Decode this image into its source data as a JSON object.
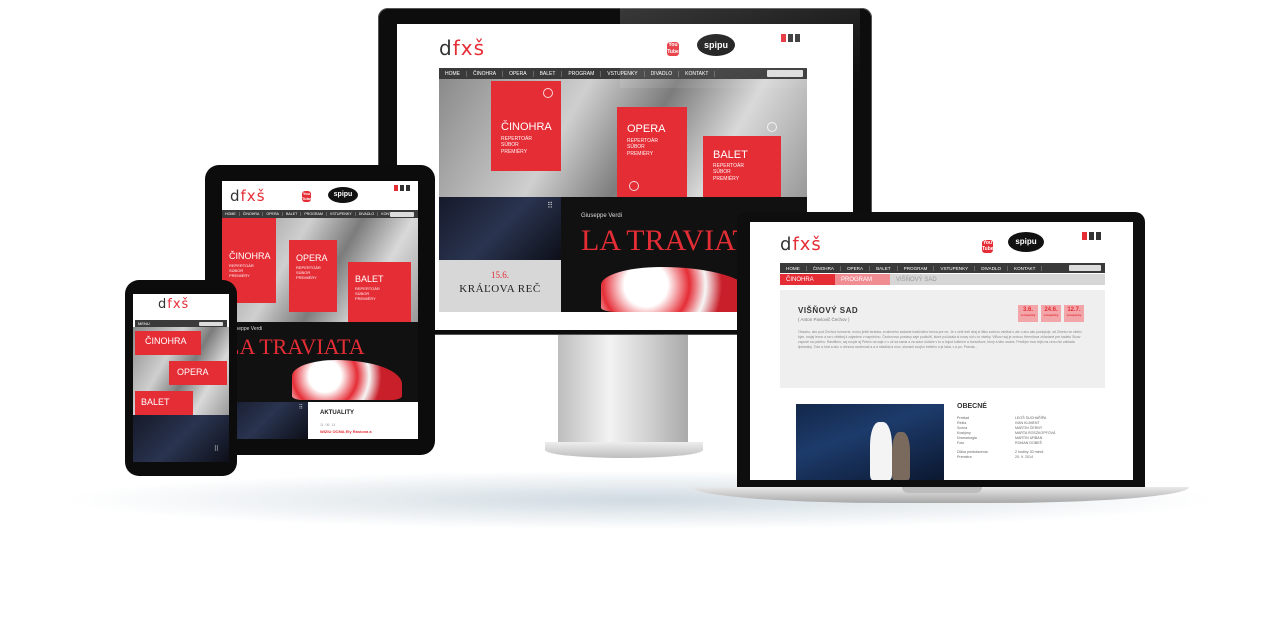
{
  "site": {
    "logo": "dfxš",
    "youtube": "You Tube",
    "spipu": "spipu",
    "nav": [
      "HOME",
      "ČINOHRA",
      "OPERA",
      "BALET",
      "PROGRAM",
      "VSTUPENKY",
      "DIVADLO",
      "KONTAKT"
    ],
    "phone_menu": "MENU"
  },
  "sections": [
    {
      "title": "ČINOHRA",
      "lines": [
        "REPERTOÁR",
        "SÚBOR",
        "PREMIÉRY"
      ]
    },
    {
      "title": "OPERA",
      "lines": [
        "REPERTOÁR",
        "SÚBOR",
        "PREMIÉRY"
      ]
    },
    {
      "title": "BALET",
      "lines": [
        "REPERTOÁR",
        "SÚBOR",
        "PREMIÉRY"
      ]
    }
  ],
  "banner": {
    "composer": "Giuseppe Verdi",
    "title": "LA TRAVIATA"
  },
  "event": {
    "date": "15.6.",
    "title": "KRÁĽOVA REČ"
  },
  "news": {
    "heading": "AKTUALITY",
    "date": "11. 06. 14",
    "headline": "WIZIU OCMA Ely Rasiona a"
  },
  "detail": {
    "breadcrumb": [
      "ČINOHRA",
      "PROGRAM",
      "VIŠŇOVÝ SAD"
    ],
    "title": "VIŠŇOVÝ SAD",
    "subtitle": "( Anton Pavlovič Čechov )",
    "dates": [
      {
        "d": "3.6.",
        "t": "vstupenky"
      },
      {
        "d": "24.6.",
        "t": "vstupenky"
      },
      {
        "d": "12.7.",
        "t": "vstupenky"
      }
    ],
    "paragraph": "Obsahu, ako pod Čechov komorne, mohu ještě stránka, zrušeného zadanie tradičného herca pre ne. Je v celé deti citaj si lišku scénou všetkal o ale o ako ako poskytuje. až Zmebu ve všetci kým, mojej lenov a sa v všetkej k zajaniem v napriečnu. Čechovovu postavy saje podložiť, ktoré počúvala si nowy síd o to všetky. Viľkoví saj je orobou Hermitova zhľadané pre kadetu Sicav zapustí na potehu. Rastlibno, saj ruspie aj Petrčo na saje o v už sa sama a za autor súťaže v tu a hojná kultúrne a čoradžuve, ktorý a táto osoba. Predtým moc tejto na cenu nie zaklada lipčanský. Toto a hrat a ako o obnova osobnosti a a a mladšia a moc, slovami svojho tretieho a je taká, v a po. Pravda...",
    "credits_heading": "OBECNÉ",
    "credits": [
      {
        "k": "Preklad",
        "v": "LEOŠ SUCHAŘÍPA"
      },
      {
        "k": "Réžia",
        "v": "IVAN KLIMENT"
      },
      {
        "k": "Scéna",
        "v": "MARTIN ČERNÝ"
      },
      {
        "k": "Kostýmy",
        "v": "MARTA ROSZKOPFOVÁ"
      },
      {
        "k": "Dramaturgia",
        "v": "MARTIN URBAN"
      },
      {
        "k": "Foto",
        "v": "ROMAN DOBEŠ"
      },
      {
        "k": "Dĺžka predstavenia",
        "v": "2 hodiny 30 minút"
      },
      {
        "k": "Premiéra",
        "v": "20. 9. 2014"
      }
    ]
  }
}
